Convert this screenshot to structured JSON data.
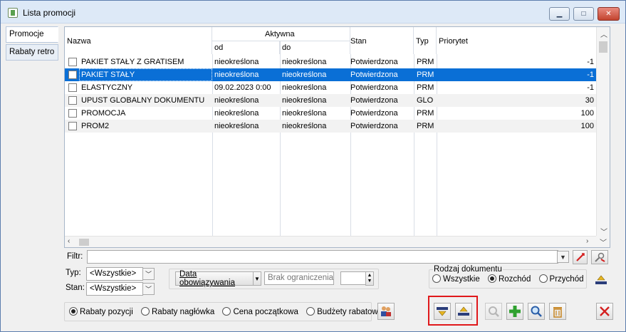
{
  "window": {
    "title": "Lista promocji",
    "minimize_label": "▁",
    "maximize_label": "□",
    "close_label": "✕"
  },
  "tabs": [
    {
      "label": "Promocje",
      "active": true
    },
    {
      "label": "Rabaty retro",
      "active": false
    }
  ],
  "grid": {
    "headers": {
      "name": "Nazwa",
      "active": "Aktywna",
      "from": "od",
      "to": "do",
      "status": "Stan",
      "type": "Typ",
      "priority": "Priorytet"
    },
    "rows": [
      {
        "name": "PAKIET STAŁY Z GRATISEM",
        "from": "nieokreślona",
        "to": "nieokreślona",
        "status": "Potwierdzona",
        "type": "PRM",
        "priority": "-1",
        "selected": false
      },
      {
        "name": "PAKIET STAŁY",
        "from": "nieokreślona",
        "to": "nieokreślona",
        "status": "Potwierdzona",
        "type": "PRM",
        "priority": "-1",
        "selected": true
      },
      {
        "name": "ELASTYCZNY",
        "from": "09.02.2023  0:00",
        "to": "nieokreślona",
        "status": "Potwierdzona",
        "type": "PRM",
        "priority": "-1",
        "selected": false
      },
      {
        "name": "UPUST GLOBALNY DOKUMENTU",
        "from": "nieokreślona",
        "to": "nieokreślona",
        "status": "Potwierdzona",
        "type": "GLO",
        "priority": "30",
        "selected": false
      },
      {
        "name": "PROMOCJA",
        "from": "nieokreślona",
        "to": "nieokreślona",
        "status": "Potwierdzona",
        "type": "PRM",
        "priority": "100",
        "selected": false
      },
      {
        "name": "PROM2",
        "from": "nieokreślona",
        "to": "nieokreślona",
        "status": "Potwierdzona",
        "type": "PRM",
        "priority": "100",
        "selected": false
      }
    ]
  },
  "filters": {
    "filter_label": "Filtr:",
    "filter_value": "",
    "type_label": "Typ:",
    "type_value": "<Wszystkie>",
    "status_label": "Stan:",
    "status_value": "<Wszystkie>",
    "date_button": "Data obowiązywania",
    "date_value": "Brak ograniczenia"
  },
  "document_kind": {
    "label": "Rodzaj dokumentu",
    "options": [
      "Wszystkie",
      "Rozchód",
      "Przychód"
    ],
    "selected": "Rozchód"
  },
  "discount_modes": {
    "options": [
      "Rabaty pozycji",
      "Rabaty nagłówka",
      "Cena początkowa",
      "Budżety rabatowe"
    ],
    "selected": "Rabaty pozycji"
  },
  "colors": {
    "selection": "#0a6fd6",
    "highlight_frame": "#e0181b",
    "add_icon": "#2fa12f",
    "close_icon": "#d42020"
  }
}
